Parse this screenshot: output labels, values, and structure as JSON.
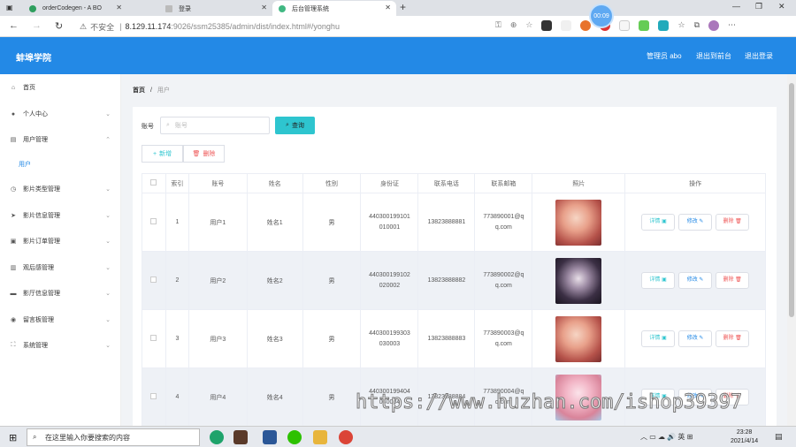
{
  "browser": {
    "tabs": [
      {
        "label": "orderCodegen - A BO",
        "color": "#2e9e5e"
      },
      {
        "label": "登录",
        "color": "#888888"
      },
      {
        "label": "后台管理系统",
        "color": "#41b883",
        "active": true
      }
    ],
    "url_secure_label": "不安全",
    "url_host": "8.129.11.174",
    "url_path": ":9026/ssm25385/admin/dist/index.html#/yonghu",
    "timer": "00:09"
  },
  "header": {
    "brand": "蚌埠学院",
    "user": "管理员 abo",
    "to_front": "退出到前台",
    "logout": "退出登录",
    "color": "#2389e6"
  },
  "sidebar": {
    "items": [
      {
        "label": "首页",
        "icon": "home-icon"
      },
      {
        "label": "个人中心",
        "icon": "user-icon"
      },
      {
        "label": "用户管理",
        "icon": "users-icon"
      },
      {
        "label": "影片类型管理",
        "icon": "clock-icon"
      },
      {
        "label": "影片信息管理",
        "icon": "send-icon"
      },
      {
        "label": "影片订单管理",
        "icon": "bag-icon"
      },
      {
        "label": "观后感管理",
        "icon": "bar-chart-icon"
      },
      {
        "label": "影厅信息管理",
        "icon": "chat-icon"
      },
      {
        "label": "留言板管理",
        "icon": "pin-icon"
      },
      {
        "label": "系统管理",
        "icon": "fullscreen-icon"
      }
    ],
    "sub_active": "用户"
  },
  "breadcrumb": {
    "home": "首页",
    "sep": "/",
    "current": "用户"
  },
  "search": {
    "label": "账号",
    "placeholder": "账号",
    "button": "查询"
  },
  "actions": {
    "add": "新增",
    "delete": "删除"
  },
  "table": {
    "headers": [
      "索引",
      "账号",
      "姓名",
      "性别",
      "身份证",
      "联系电话",
      "联系邮箱",
      "照片",
      "操作"
    ],
    "rows": [
      {
        "index": "1",
        "account": "用户1",
        "name": "姓名1",
        "gender": "男",
        "id_a": "440300199101",
        "id_b": "010001",
        "phone": "13823888881",
        "email_a": "773890001@q",
        "email_b": "q.com"
      },
      {
        "index": "2",
        "account": "用户2",
        "name": "姓名2",
        "gender": "男",
        "id_a": "440300199102",
        "id_b": "020002",
        "phone": "13823888882",
        "email_a": "773890002@q",
        "email_b": "q.com"
      },
      {
        "index": "3",
        "account": "用户3",
        "name": "姓名3",
        "gender": "男",
        "id_a": "440300199303",
        "id_b": "030003",
        "phone": "13823888883",
        "email_a": "773890003@q",
        "email_b": "q.com"
      },
      {
        "index": "4",
        "account": "用户4",
        "name": "姓名4",
        "gender": "男",
        "id_a": "440300199404",
        "id_b": "040004",
        "phone": "13823888884",
        "email_a": "773890004@q",
        "email_b": "q.com"
      }
    ],
    "row_buttons": {
      "detail": "详情",
      "edit": "修改",
      "remove": "删除"
    }
  },
  "watermark": "https://www.huzhan.com/ishop39397",
  "taskbar": {
    "search_placeholder": "在这里输入你要搜索的内容",
    "time": "23:28",
    "date": "2021/4/14"
  }
}
